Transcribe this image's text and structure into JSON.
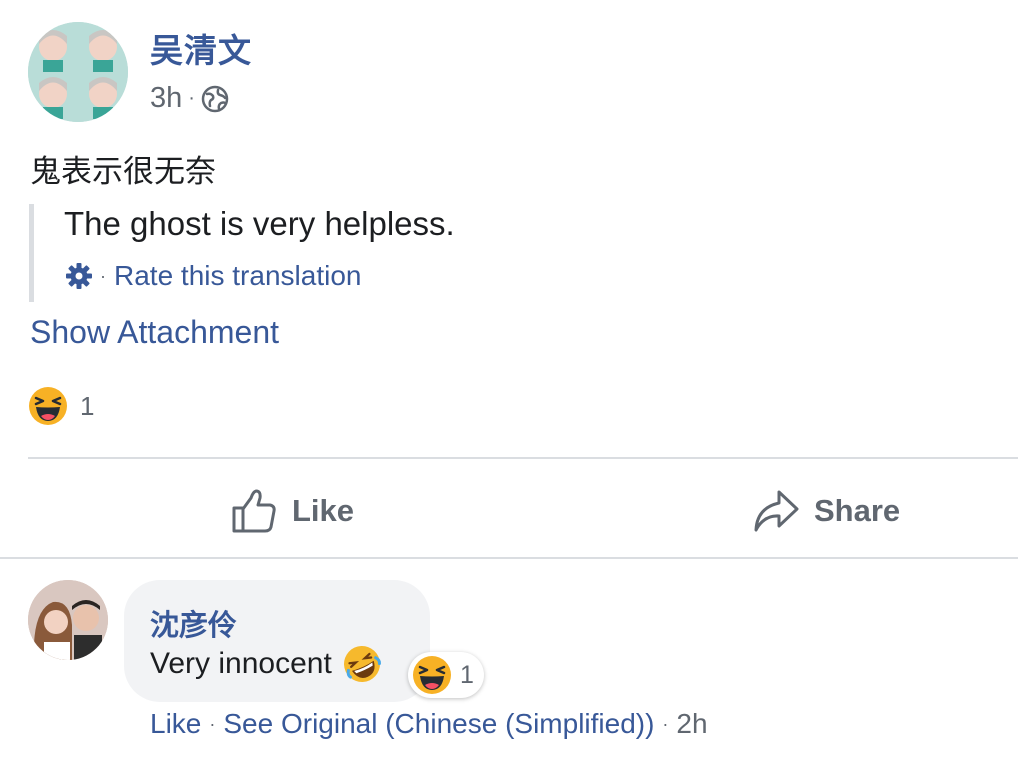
{
  "post": {
    "author": "吴清文",
    "time": "3h",
    "meta_separator": "·",
    "text": "鬼表示很无奈",
    "translation": {
      "text": "The ghost is very helpless.",
      "separator": "·",
      "rate_label": "Rate this translation"
    },
    "show_attachment": "Show Attachment",
    "reactions": {
      "icon": "laugh-emoji-icon",
      "count": "1"
    }
  },
  "actions": {
    "like_label": "Like",
    "share_label": "Share"
  },
  "comment": {
    "author": "沈彦伶",
    "text": "Very innocent",
    "inline_emoji": "rolling-laughing-emoji-icon",
    "reaction_count": "1",
    "footer": {
      "like": "Like",
      "sep1": "·",
      "see_original": "See Original (Chinese (Simplified))",
      "sep2": "·",
      "time": "2h"
    }
  },
  "colors": {
    "link": "#385898",
    "muted": "#606770",
    "divider": "#dadde1",
    "bubble": "#f2f3f5"
  }
}
